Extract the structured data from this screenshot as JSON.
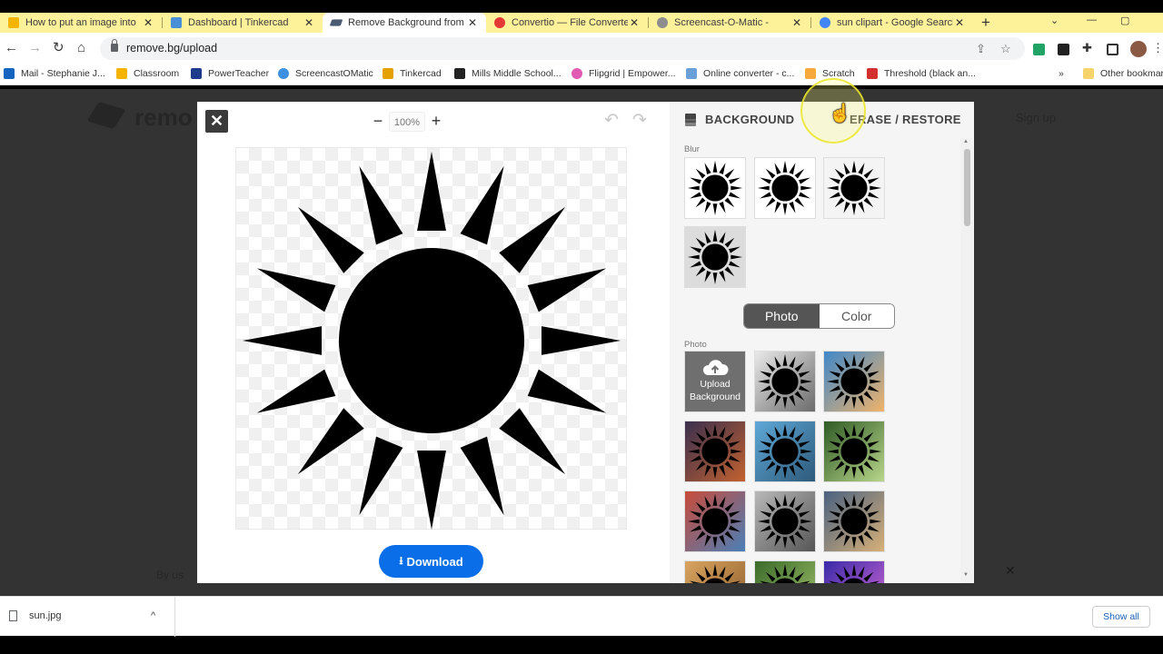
{
  "browser": {
    "tabs": [
      {
        "title": "How to put an image into",
        "favicon_color": "#f4b400"
      },
      {
        "title": "Dashboard | Tinkercad",
        "favicon_color": "#4a90d9"
      },
      {
        "title": "Remove Background from",
        "favicon_color": "#4a5a73"
      },
      {
        "title": "Convertio — File Converter",
        "favicon_color": "#e53935"
      },
      {
        "title": "Screencast-O-Matic -",
        "favicon_color": "#8e8e8e"
      },
      {
        "title": "sun clipart - Google Search",
        "favicon_color": "#4285f4"
      }
    ],
    "active_tab": 2,
    "close_glyph": "✕",
    "new_tab_glyph": "+",
    "url": "remove.bg/upload"
  },
  "bookmarks": [
    {
      "label": "Mail - Stephanie J...",
      "color": "#1565c0"
    },
    {
      "label": "Classroom",
      "color": "#f4b400"
    },
    {
      "label": "PowerTeacher",
      "color": "#1e3a8a"
    },
    {
      "label": "ScreencastOMatic",
      "color": "#3d8fe0"
    },
    {
      "label": "Tinkercad",
      "color": "#e5a100"
    },
    {
      "label": "Mills Middle School...",
      "color": "#222222"
    },
    {
      "label": "Flipgrid | Empower...",
      "color": "#e15ab3"
    },
    {
      "label": "Online converter - c...",
      "color": "#6aa0d8"
    },
    {
      "label": "Scratch",
      "color": "#f7a93b"
    },
    {
      "label": "Threshold (black an...",
      "color": "#d32f2f"
    }
  ],
  "bookmarks_overflow": "»",
  "other_bookmarks": "Other bookmarks",
  "background_page": {
    "logo": "remo",
    "signup": "Sign up",
    "footer_text": "By us"
  },
  "editor": {
    "close_glyph": "✕",
    "zoom_minus": "−",
    "zoom_value": "100%",
    "zoom_plus": "+",
    "undo_glyph": "↶",
    "redo_glyph": "↷",
    "download_label": "Download",
    "download_icon": "download-icon"
  },
  "panel": {
    "tab_background": "BACKGROUND",
    "tab_erase": "ERASE / RESTORE",
    "blur_label": "Blur",
    "toggle_photo": "Photo",
    "toggle_color": "Color",
    "photo_label": "Photo",
    "upload_line1": "Upload",
    "upload_line2": "Background"
  },
  "download_shelf": {
    "filename": "sun.jpg",
    "chevron": "^",
    "show_all": "Show all"
  },
  "colors": {
    "accent_blue": "#0a6ee9",
    "tab_strip": "#fdf19a"
  }
}
